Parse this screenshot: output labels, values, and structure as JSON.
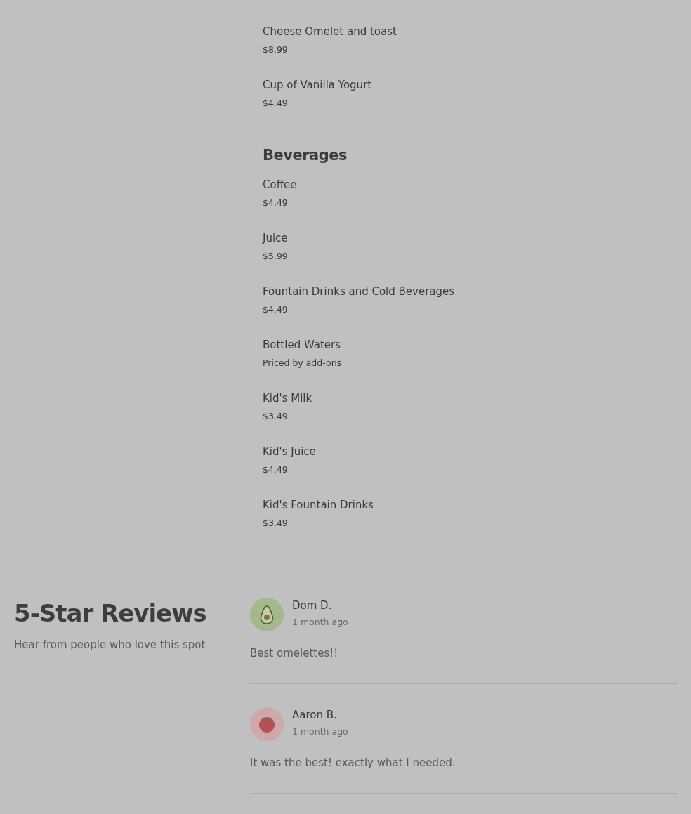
{
  "menu": {
    "sections": [
      {
        "items": [
          {
            "name": "Cheese Omelet and toast",
            "price": "$8.99"
          },
          {
            "name": "Cup of Vanilla Yogurt",
            "price": "$4.49"
          }
        ]
      },
      {
        "title": "Beverages",
        "items": [
          {
            "name": "Coffee",
            "price": "$4.49"
          },
          {
            "name": "Juice",
            "price": "$5.99"
          },
          {
            "name": "Fountain Drinks and Cold Beverages",
            "price": "$4.49"
          },
          {
            "name": "Bottled Waters",
            "price": "Priced by add-ons"
          },
          {
            "name": "Kid's Milk",
            "price": "$3.49"
          },
          {
            "name": "Kid's Juice",
            "price": "$4.49"
          },
          {
            "name": "Kid's Fountain Drinks",
            "price": "$3.49"
          }
        ]
      }
    ]
  },
  "reviews": {
    "title": "5-Star Reviews",
    "subtitle": "Hear from people who love this spot",
    "items": [
      {
        "kind": "avocado",
        "author": "Dom D.",
        "time": "1 month ago",
        "text": "Best omelettes!!"
      },
      {
        "kind": "tomato",
        "author": "Aaron B.",
        "time": "1 month ago",
        "text": "It was the best! exactly what I needed."
      }
    ]
  }
}
